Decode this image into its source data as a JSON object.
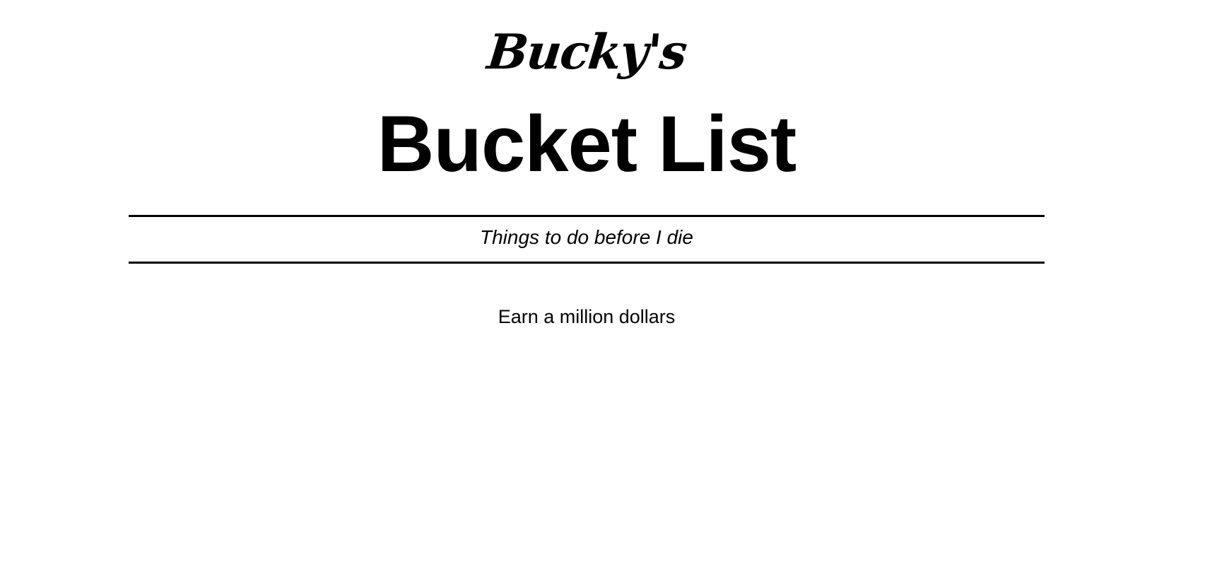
{
  "header": {
    "logo_text": "Bucky's",
    "title": "Bucket List",
    "tagline": "Things to do before I die"
  },
  "list": {
    "items": [
      {
        "label": "Earn a million dollars"
      }
    ]
  },
  "colors": {
    "text": "#000000",
    "background": "#ffffff",
    "rule": "#000000"
  }
}
